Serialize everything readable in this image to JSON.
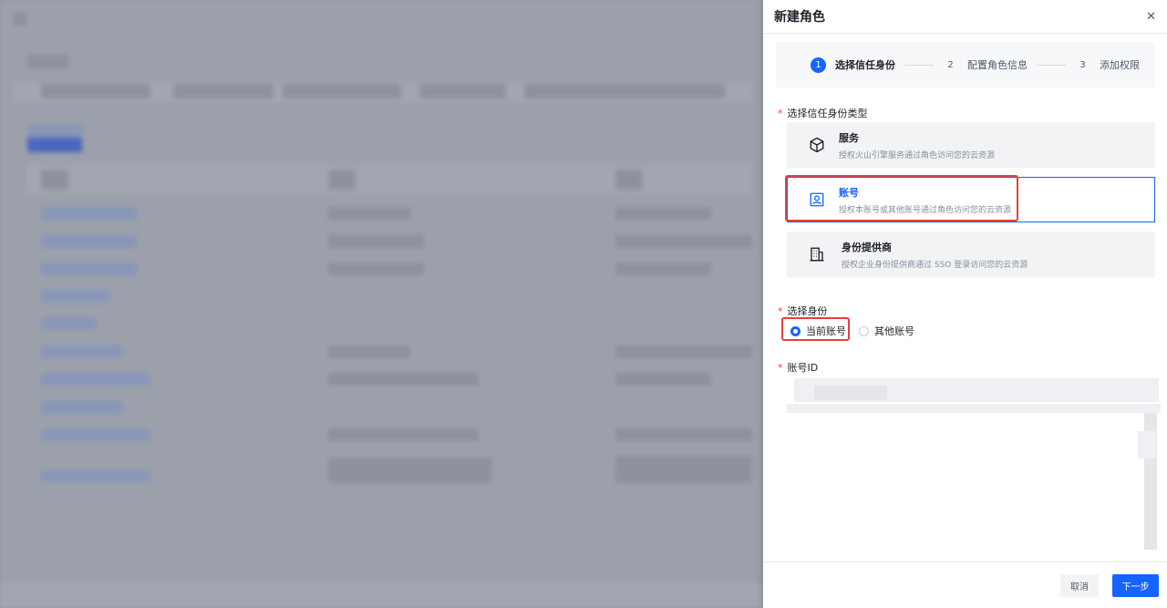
{
  "drawer": {
    "title": "新建角色",
    "close_icon": "close-icon"
  },
  "steps": [
    {
      "num": "1",
      "label": "选择信任身份",
      "active": true
    },
    {
      "num": "2",
      "label": "配置角色信息",
      "active": false
    },
    {
      "num": "3",
      "label": "添加权限",
      "active": false
    }
  ],
  "trust_type": {
    "required_mark": "*",
    "label": "选择信任身份类型",
    "options": [
      {
        "icon": "cube-icon",
        "title": "服务",
        "desc": "授权火山引擎服务通过角色访问您的云资源",
        "selected": false
      },
      {
        "icon": "user-card-icon",
        "title": "账号",
        "desc": "授权本账号或其他账号通过角色访问您的云资源",
        "selected": true
      },
      {
        "icon": "building-icon",
        "title": "身份提供商",
        "desc": "授权企业身份提供商通过 SSO 登录访问您的云资源",
        "selected": false
      }
    ]
  },
  "identity": {
    "required_mark": "*",
    "label": "选择身份",
    "options": [
      {
        "label": "当前账号",
        "checked": true
      },
      {
        "label": "其他账号",
        "checked": false
      }
    ]
  },
  "account_id": {
    "required_mark": "*",
    "label": "账号ID"
  },
  "footer": {
    "cancel_label": "取消",
    "next_label": "下一步"
  },
  "colors": {
    "primary": "#1664ff",
    "highlight": "#e5403d",
    "required": "#f53f3f"
  }
}
